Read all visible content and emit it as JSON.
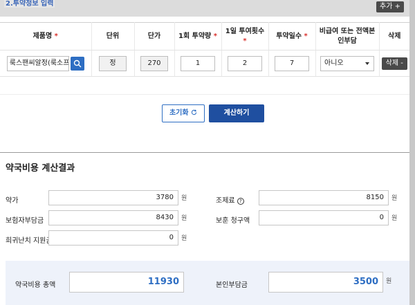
{
  "header": {
    "section_title": "2.투약정보 입력",
    "add_button": "추가 +"
  },
  "table": {
    "headers": [
      {
        "label": "제품명",
        "required": true
      },
      {
        "label": "단위",
        "required": false
      },
      {
        "label": "단가",
        "required": false
      },
      {
        "label": "1회 투약량",
        "required": true
      },
      {
        "label": "1일 투여횟수",
        "required": true
      },
      {
        "label": "투약일수",
        "required": true
      },
      {
        "label": "비급여 또는 전액본인부담",
        "required": false
      },
      {
        "label": "삭제",
        "required": false
      }
    ],
    "row": {
      "product_name": "룩스팬씨알정(룩소프로",
      "unit": "정",
      "unit_price": "270",
      "dose_per_time": "1",
      "times_per_day": "2",
      "days": "7",
      "non_covered": "아니오",
      "delete_label": "삭제 -"
    }
  },
  "actions": {
    "reset_label": "초기화",
    "calc_label": "계산하기"
  },
  "result": {
    "title": "약국비용 계산결과",
    "unit": "원",
    "drug_cost_label": "약가",
    "drug_cost": "3780",
    "prep_fee_label": "조제료",
    "prep_fee": "8150",
    "insurer_label": "보험자부담금",
    "insurer": "8430",
    "welfare_label": "보훈 청구액",
    "welfare": "0",
    "rare_label": "희귀난치 지원금",
    "rare": "0",
    "total_label": "약국비용 총액",
    "total": "11930",
    "patient_label": "본인부담금",
    "patient": "3500"
  },
  "colors": {
    "accent": "#2e6ec3",
    "primary_button": "#1f4fa0",
    "required": "#d9302c"
  }
}
